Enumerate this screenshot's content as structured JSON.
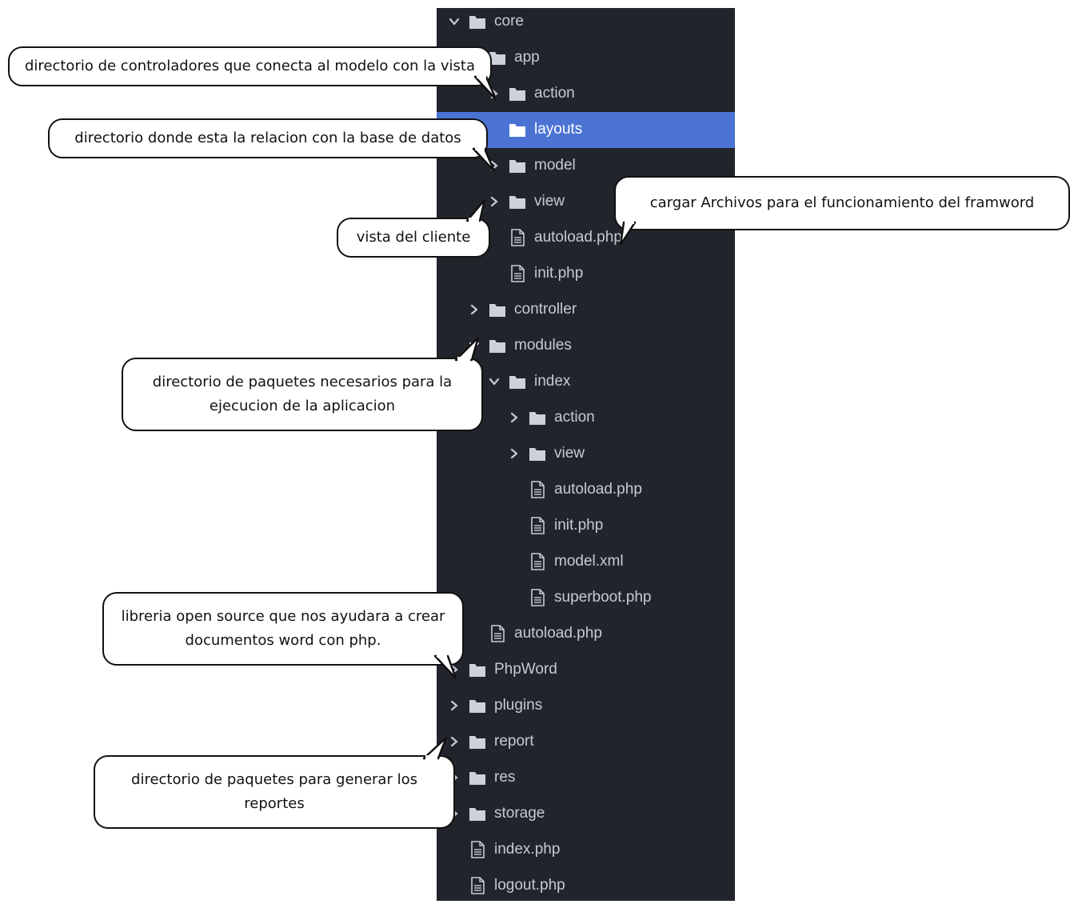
{
  "tree": {
    "selected_color": "#4a73d4",
    "items": [
      {
        "label": "core",
        "type": "folder",
        "chevron": "down"
      },
      {
        "label": "app",
        "type": "folder",
        "chevron": "down"
      },
      {
        "label": "action",
        "type": "folder",
        "chevron": "right"
      },
      {
        "label": "layouts",
        "type": "folder",
        "chevron": "none",
        "selected": true
      },
      {
        "label": "model",
        "type": "folder",
        "chevron": "right"
      },
      {
        "label": "view",
        "type": "folder",
        "chevron": "right"
      },
      {
        "label": "autoload.php",
        "type": "file"
      },
      {
        "label": "init.php",
        "type": "file"
      },
      {
        "label": "controller",
        "type": "folder",
        "chevron": "right"
      },
      {
        "label": "modules",
        "type": "folder",
        "chevron": "down"
      },
      {
        "label": "index",
        "type": "folder",
        "chevron": "down"
      },
      {
        "label": "action",
        "type": "folder",
        "chevron": "right"
      },
      {
        "label": "view",
        "type": "folder",
        "chevron": "right"
      },
      {
        "label": "autoload.php",
        "type": "file"
      },
      {
        "label": "init.php",
        "type": "file"
      },
      {
        "label": "model.xml",
        "type": "file"
      },
      {
        "label": "superboot.php",
        "type": "file"
      },
      {
        "label": "autoload.php",
        "type": "file"
      },
      {
        "label": "PhpWord",
        "type": "folder",
        "chevron": "right"
      },
      {
        "label": "plugins",
        "type": "folder",
        "chevron": "right"
      },
      {
        "label": "report",
        "type": "folder",
        "chevron": "right"
      },
      {
        "label": "res",
        "type": "folder",
        "chevron": "right"
      },
      {
        "label": "storage",
        "type": "folder",
        "chevron": "right"
      },
      {
        "label": "index.php",
        "type": "file"
      },
      {
        "label": "logout.php",
        "type": "file"
      }
    ]
  },
  "callouts": {
    "controllers": "directorio de controladores que conecta al modelo con la vista",
    "database": "directorio donde esta la relacion con la base de datos",
    "client_view": "vista del cliente",
    "autoload": "cargar Archivos para el funcionamiento del framword",
    "modules_line1": "directorio de paquetes necesarios para la",
    "modules_line2": "ejecucion de la aplicacion",
    "phpword_line1": "libreria open source que nos ayudara a crear",
    "phpword_line2": "documentos word con php.",
    "reports_line1": "directorio de paquetes para generar los",
    "reports_line2": "reportes"
  }
}
